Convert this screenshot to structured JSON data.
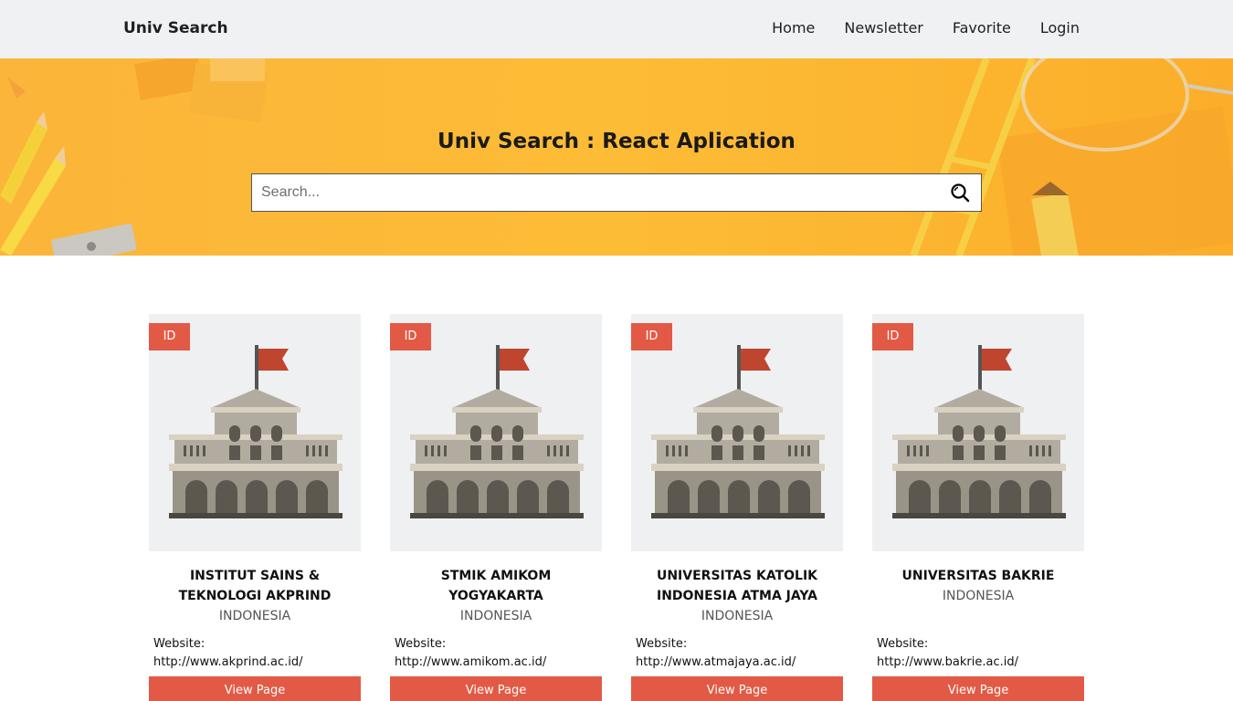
{
  "navbar": {
    "brand": "Univ Search",
    "links": [
      "Home",
      "Newsletter",
      "Favorite",
      "Login"
    ]
  },
  "hero": {
    "title": "Univ Search : React Aplication",
    "search": {
      "placeholder": "Search...",
      "value": ""
    },
    "search_icon": "search-icon"
  },
  "colors": {
    "accent": "#e25a45",
    "hero_bg": "#fdbc36",
    "navbar_bg": "#f0f1f3",
    "card_bg": "#eff0f2"
  },
  "cards": [
    {
      "badge": "ID",
      "name": "INSTITUT SAINS & TEKNOLOGI AKPRIND",
      "country": "INDONESIA",
      "website_label": "Website:",
      "website": "http://www.akprind.ac.id/",
      "button": "View Page"
    },
    {
      "badge": "ID",
      "name": "STMIK AMIKOM YOGYAKARTA",
      "country": "INDONESIA",
      "website_label": "Website:",
      "website": "http://www.amikom.ac.id/",
      "button": "View Page"
    },
    {
      "badge": "ID",
      "name": "UNIVERSITAS KATOLIK INDONESIA ATMA JAYA",
      "country": "INDONESIA",
      "website_label": "Website:",
      "website": "http://www.atmajaya.ac.id/",
      "button": "View Page"
    },
    {
      "badge": "ID",
      "name": "UNIVERSITAS BAKRIE",
      "country": "INDONESIA",
      "website_label": "Website:",
      "website": "http://www.bakrie.ac.id/",
      "button": "View Page"
    }
  ]
}
